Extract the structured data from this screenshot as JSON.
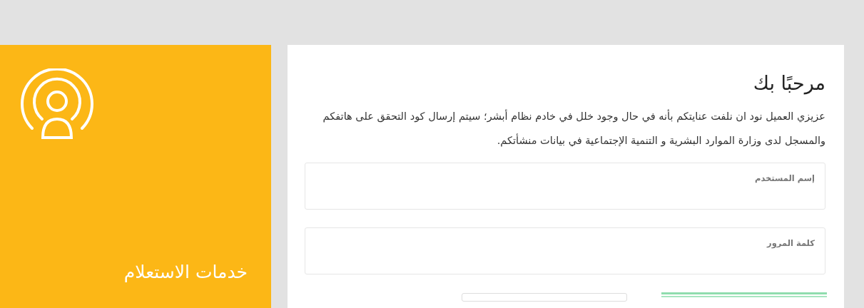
{
  "side_panel": {
    "title": "خدمات الاستعلام"
  },
  "card": {
    "heading": "مرحبًا بك",
    "message": "عزيزي العميل نود ان نلفت عنايتكم بأنه في حال وجود خلل في خادم نظام أبشر؛ سيتم إرسال كود التحقق على هاتفكم والمسجل لدى وزارة الموارد البشرية و التنمية الإجتماعية في بيانات منشأتكم.",
    "fields": [
      {
        "label": "إسم المستخدم"
      },
      {
        "label": "كلمة المرور"
      }
    ]
  }
}
